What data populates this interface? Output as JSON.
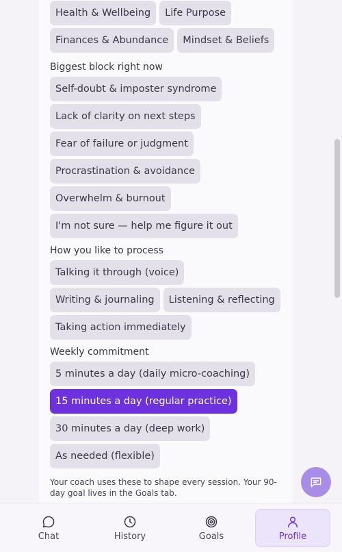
{
  "groups": [
    {
      "label": "",
      "chips": [
        "Health & Wellbeing",
        "Life Purpose",
        "Finances & Abundance",
        "Mindset & Beliefs"
      ]
    },
    {
      "label": "Biggest block right now",
      "chips": [
        "Self-doubt & imposter syndrome",
        "Lack of clarity on next steps",
        "Fear of failure or judgment",
        "Procrastination & avoidance",
        "Overwhelm & burnout",
        "I'm not sure — help me figure it out"
      ]
    },
    {
      "label": "How you like to process",
      "chips": [
        "Talking it through (voice)",
        "Writing & journaling",
        "Listening & reflecting",
        "Taking action immediately"
      ]
    },
    {
      "label": "Weekly commitment",
      "chips": [
        "5 minutes a day (daily micro-coaching)",
        "15 minutes a day (regular practice)",
        "30 minutes a day (deep work)",
        "As needed (flexible)"
      ],
      "selected": "15 minutes a day (regular practice)"
    }
  ],
  "footnote": "Your coach uses these to shape every session. Your 90-day goal lives in the Goals tab.",
  "nav": {
    "chat": "Chat",
    "history": "History",
    "goals": "Goals",
    "profile": "Profile"
  },
  "colors": {
    "accent": "#6d31de",
    "chip": "#e4e0ea",
    "fab": "#a98ce8"
  }
}
